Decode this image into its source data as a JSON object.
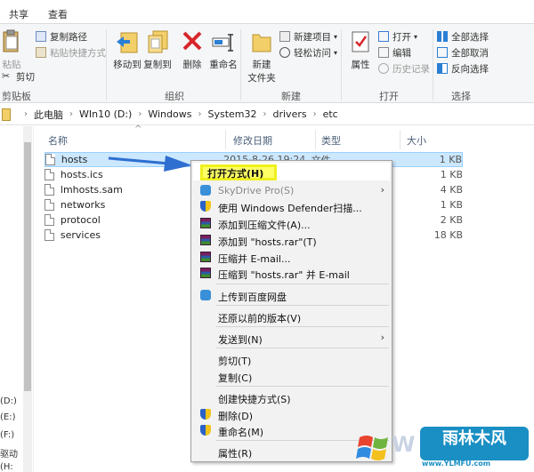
{
  "tabs": [
    "共享",
    "查看"
  ],
  "ribbon": {
    "clipboard": {
      "group_label": "剪贴板",
      "copy_path": "复制路径",
      "paste_shortcut": "粘贴快捷方式",
      "paste": "粘贴",
      "cut": "剪切"
    },
    "organize": {
      "group_label": "组织",
      "move_to": "移动到",
      "copy_to": "复制到",
      "delete": "删除",
      "rename": "重命名"
    },
    "new": {
      "group_label": "新建",
      "new_folder_1": "新建",
      "new_folder_2": "文件夹",
      "new_item": "新建项目",
      "easy_access": "轻松访问"
    },
    "open": {
      "group_label": "打开",
      "properties": "属性",
      "open": "打开",
      "edit": "编辑",
      "history": "历史记录"
    },
    "select": {
      "group_label": "选择",
      "select_all": "全部选择",
      "select_none": "全部取消",
      "invert": "反向选择"
    }
  },
  "breadcrumb": [
    "此电脑",
    "WIn10 (D:)",
    "Windows",
    "System32",
    "drivers",
    "etc"
  ],
  "nav": [
    "(D:)",
    "(E:)",
    "(F:)",
    "驱动",
    "(H:"
  ],
  "columns": {
    "name": "名称",
    "date": "修改日期",
    "type": "类型",
    "size": "大小"
  },
  "files": [
    {
      "name": "hosts",
      "date": "2015-8-26 19:24",
      "type": "文件",
      "size": "1 KB"
    },
    {
      "name": "hosts.ics",
      "date": "",
      "type": "",
      "size": "1 KB"
    },
    {
      "name": "lmhosts.sam",
      "date": "",
      "type": "",
      "size": "4 KB"
    },
    {
      "name": "networks",
      "date": "",
      "type": "",
      "size": "1 KB"
    },
    {
      "name": "protocol",
      "date": "",
      "type": "",
      "size": "2 KB"
    },
    {
      "name": "services",
      "date": "",
      "type": "",
      "size": "18 KB"
    }
  ],
  "menu": {
    "open_with": "打开方式(H)",
    "skydrive": "SkyDrive Pro(S)",
    "defender": "使用 Windows Defender扫描...",
    "add_archive": "添加到压缩文件(A)...",
    "add_rar": "添加到 \"hosts.rar\"(T)",
    "compress_email": "压缩并 E-mail...",
    "compress_rar_email": "压缩到 \"hosts.rar\" 并 E-mail",
    "baidu": "上传到百度网盘",
    "restore": "还原以前的版本(V)",
    "send_to": "发送到(N)",
    "cut": "剪切(T)",
    "copy": "复制(C)",
    "shortcut": "创建快捷方式(S)",
    "delete": "删除(D)",
    "rename": "重命名(M)",
    "properties": "属性(R)"
  },
  "watermark": {
    "logo": "雨林木风",
    "url": "www.YLMFU.com"
  },
  "colors": {
    "selection": "#cce8ff",
    "highlight": "#ffff66",
    "arrow": "#2f6fd0"
  }
}
